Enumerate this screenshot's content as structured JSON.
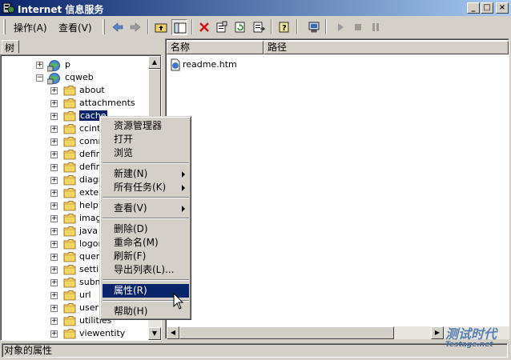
{
  "window": {
    "title": "Internet 信息服务"
  },
  "title_buttons": {
    "minimize": "_",
    "maximize": "□",
    "close": "×"
  },
  "menu": [
    "操作(A)",
    "查看(V)"
  ],
  "tree_tab": "树",
  "tree": [
    {
      "label": "p",
      "icon": "web-site-icon",
      "level": 1,
      "expander": "+"
    },
    {
      "label": "cqweb",
      "icon": "web-site-icon",
      "level": 1,
      "expander": "−"
    },
    {
      "label": "about",
      "icon": "folder-icon",
      "level": 2,
      "expander": "+"
    },
    {
      "label": "attachments",
      "icon": "folder-icon",
      "level": 2,
      "expander": "+"
    },
    {
      "label": "cache",
      "icon": "folder-icon",
      "level": 2,
      "expander": "+",
      "selected": true
    },
    {
      "label": "ccint",
      "icon": "folder-icon",
      "level": 2,
      "expander": "+"
    },
    {
      "label": "comm",
      "icon": "folder-icon",
      "level": 2,
      "expander": "+"
    },
    {
      "label": "defin",
      "icon": "folder-icon",
      "level": 2,
      "expander": "+"
    },
    {
      "label": "defin",
      "icon": "folder-icon",
      "level": 2,
      "expander": "+"
    },
    {
      "label": "diagn",
      "icon": "folder-icon",
      "level": 2,
      "expander": "+"
    },
    {
      "label": "exter",
      "icon": "folder-icon",
      "level": 2,
      "expander": "+"
    },
    {
      "label": "help",
      "icon": "folder-icon",
      "level": 2,
      "expander": "+"
    },
    {
      "label": "imag",
      "icon": "folder-icon",
      "level": 2,
      "expander": "+"
    },
    {
      "label": "java",
      "icon": "folder-icon",
      "level": 2,
      "expander": "+"
    },
    {
      "label": "logon",
      "icon": "folder-icon",
      "level": 2,
      "expander": "+"
    },
    {
      "label": "quer",
      "icon": "folder-icon",
      "level": 2,
      "expander": "+"
    },
    {
      "label": "settin",
      "icon": "folder-icon",
      "level": 2,
      "expander": "+"
    },
    {
      "label": "subm",
      "icon": "folder-icon",
      "level": 2,
      "expander": "+"
    },
    {
      "label": "url",
      "icon": "folder-icon",
      "level": 2,
      "expander": "+"
    },
    {
      "label": "user",
      "icon": "folder-icon",
      "level": 2,
      "expander": "+"
    },
    {
      "label": "utilities",
      "icon": "folder-icon",
      "level": 2,
      "expander": "+"
    },
    {
      "label": "viewentity",
      "icon": "folder-icon",
      "level": 2,
      "expander": "+"
    }
  ],
  "list": {
    "columns": [
      "名称",
      "路径"
    ],
    "items": [
      {
        "name": "readme.htm",
        "path": ""
      }
    ]
  },
  "context_menu": [
    {
      "label": "资源管理器"
    },
    {
      "label": "打开"
    },
    {
      "label": "浏览"
    },
    {
      "separator": true
    },
    {
      "label": "新建(N)",
      "submenu": true
    },
    {
      "label": "所有任务(K)",
      "submenu": true
    },
    {
      "separator": true
    },
    {
      "label": "查看(V)",
      "submenu": true
    },
    {
      "separator": true
    },
    {
      "label": "删除(D)"
    },
    {
      "label": "重命名(M)"
    },
    {
      "label": "刷新(F)"
    },
    {
      "label": "导出列表(L)..."
    },
    {
      "separator": true
    },
    {
      "label": "属性(R)",
      "highlighted": true
    },
    {
      "separator": true
    },
    {
      "label": "帮助(H)"
    }
  ],
  "statusbar": {
    "text": "对象的属性"
  },
  "watermark": {
    "main": "测试时代",
    "sub": "Testage.net"
  },
  "colors": {
    "titlebar": "#0a246a",
    "selection": "#0a246a",
    "face": "#d4d0c8"
  }
}
